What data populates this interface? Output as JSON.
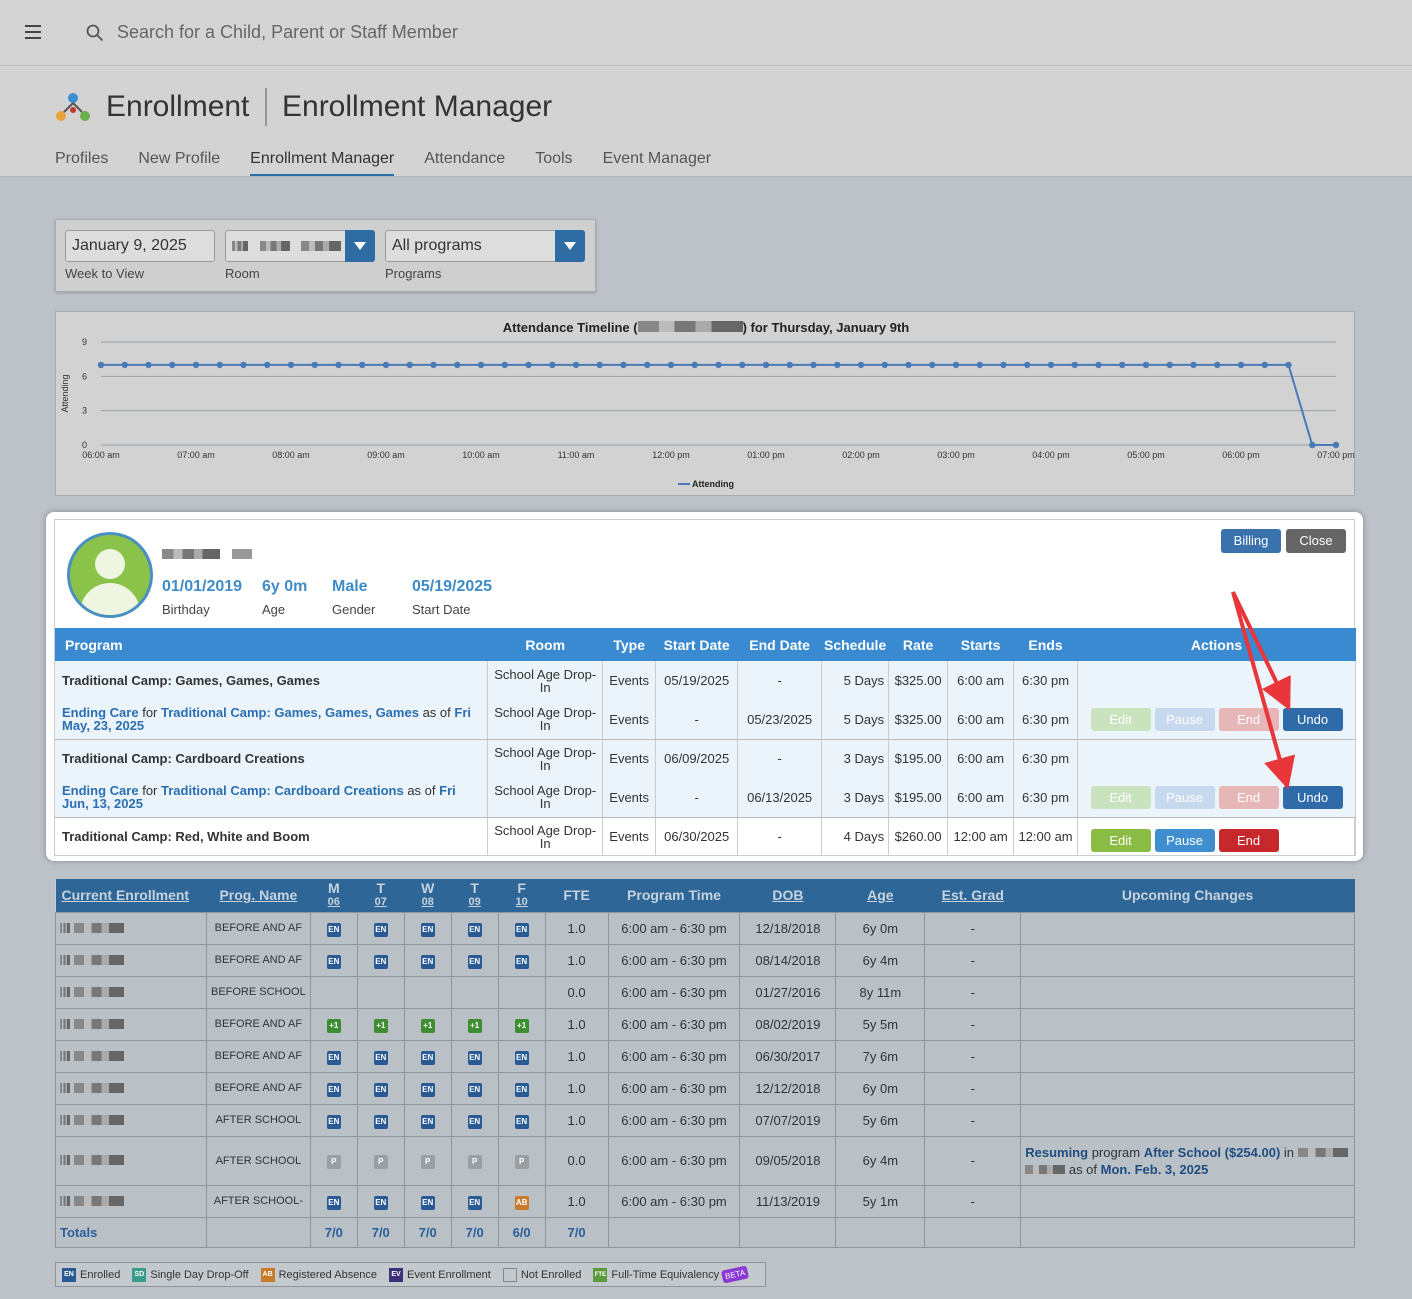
{
  "search": {
    "placeholder": "Search for a Child, Parent or Staff Member"
  },
  "header": {
    "title": "Enrollment",
    "subtitle": "Enrollment Manager"
  },
  "tabs": [
    {
      "label": "Profiles"
    },
    {
      "label": "New Profile"
    },
    {
      "label": "Enrollment Manager",
      "active": true
    },
    {
      "label": "Attendance"
    },
    {
      "label": "Tools"
    },
    {
      "label": "Event Manager"
    }
  ],
  "filters": {
    "week_value": "January 9, 2025",
    "week_label": "Week to View",
    "room_label": "Room",
    "programs_value": "All programs",
    "programs_label": "Programs"
  },
  "chart_data": {
    "type": "line",
    "title_prefix": "Attendance Timeline (",
    "title_suffix": ") for Thursday, January 9th",
    "ylabel": "Attending",
    "ylim": [
      0,
      9
    ],
    "yticks": [
      "0",
      "3",
      "6",
      "9"
    ],
    "xticks": [
      "06:00 am",
      "07:00 am",
      "08:00 am",
      "09:00 am",
      "10:00 am",
      "11:00 am",
      "12:00 pm",
      "01:00 pm",
      "02:00 pm",
      "03:00 pm",
      "04:00 pm",
      "05:00 pm",
      "06:00 pm",
      "07:00 pm"
    ],
    "series": [
      {
        "name": "Attending",
        "color": "#4a7ab5",
        "values": [
          7,
          7,
          7,
          7,
          7,
          7,
          7,
          7,
          7,
          7,
          7,
          7,
          7,
          7,
          7,
          7,
          7,
          7,
          7,
          7,
          7,
          7,
          7,
          7,
          7,
          7,
          7,
          7,
          7,
          7,
          7,
          7,
          7,
          7,
          7,
          7,
          7,
          7,
          7,
          7,
          7,
          7,
          7,
          7,
          7,
          7,
          7,
          7,
          7,
          7,
          7,
          0,
          0
        ]
      }
    ],
    "x_step_minutes": 15,
    "legend": "bottom-center",
    "grid": true
  },
  "profile": {
    "birthday": "01/01/2019",
    "birthday_label": "Birthday",
    "age": "6y 0m",
    "age_label": "Age",
    "gender": "Male",
    "gender_label": "Gender",
    "start_date": "05/19/2025",
    "start_date_label": "Start Date",
    "billing_label": "Billing",
    "close_label": "Close"
  },
  "program_table": {
    "headers": [
      "Program",
      "Room",
      "Type",
      "Start Date",
      "End Date",
      "Schedule",
      "Rate",
      "Starts",
      "Ends",
      "Actions"
    ],
    "action_labels": {
      "edit": "Edit",
      "pause": "Pause",
      "end": "End",
      "undo": "Undo"
    },
    "rows": [
      {
        "program": "Traditional Camp: Games, Games, Games",
        "room": "School Age Drop-In",
        "type": "Events",
        "start": "05/19/2025",
        "end": "-",
        "schedule": "5 Days",
        "rate": "$325.00",
        "starts": "6:00 am",
        "ends": "6:30 pm"
      },
      {
        "ending_prefix": "Ending Care",
        "ending_for": "for",
        "ending_program": "Traditional Camp: Games, Games, Games",
        "ending_asof": "as of",
        "ending_date": "Fri May, 23, 2025",
        "room": "School Age Drop-In",
        "type": "Events",
        "start": "-",
        "end": "05/23/2025",
        "schedule": "5 Days",
        "rate": "$325.00",
        "starts": "6:00 am",
        "ends": "6:30 pm"
      },
      {
        "program": "Traditional Camp: Cardboard Creations",
        "room": "School Age Drop-In",
        "type": "Events",
        "start": "06/09/2025",
        "end": "-",
        "schedule": "3 Days",
        "rate": "$195.00",
        "starts": "6:00 am",
        "ends": "6:30 pm"
      },
      {
        "ending_prefix": "Ending Care",
        "ending_for": "for",
        "ending_program": "Traditional Camp: Cardboard Creations",
        "ending_asof": "as of",
        "ending_date": "Fri Jun, 13, 2025",
        "room": "School Age Drop-In",
        "type": "Events",
        "start": "-",
        "end": "06/13/2025",
        "schedule": "3 Days",
        "rate": "$195.00",
        "starts": "6:00 am",
        "ends": "6:30 pm"
      },
      {
        "program": "Traditional Camp: Red, White and Boom",
        "room": "School Age Drop-In",
        "type": "Events",
        "start": "06/30/2025",
        "end": "-",
        "schedule": "4 Days",
        "rate": "$260.00",
        "starts": "12:00 am",
        "ends": "12:00 am"
      }
    ]
  },
  "enrollment_table": {
    "headers": {
      "current": "Current Enrollment",
      "prog": "Prog. Name",
      "m": "M",
      "m_d": "06",
      "t": "T",
      "t_d": "07",
      "w": "W",
      "w_d": "08",
      "th": "T",
      "th_d": "09",
      "f": "F",
      "f_d": "10",
      "fte": "FTE",
      "time": "Program Time",
      "dob": "DOB",
      "age": "Age",
      "grad": "Est. Grad",
      "changes": "Upcoming Changes"
    },
    "rows": [
      {
        "prog": "BEFORE AND AF",
        "days": [
          "EN",
          "EN",
          "EN",
          "EN",
          "EN"
        ],
        "fte": "1.0",
        "time": "6:00 am - 6:30 pm",
        "dob": "12/18/2018",
        "age": "6y 0m",
        "grad": "-"
      },
      {
        "prog": "BEFORE AND AF",
        "days": [
          "EN",
          "EN",
          "EN",
          "EN",
          "EN"
        ],
        "fte": "1.0",
        "time": "6:00 am - 6:30 pm",
        "dob": "08/14/2018",
        "age": "6y 4m",
        "grad": "-"
      },
      {
        "prog": "BEFORE SCHOOL",
        "days": [
          "",
          "",
          "",
          "",
          ""
        ],
        "fte": "0.0",
        "time": "6:00 am - 6:30 pm",
        "dob": "01/27/2016",
        "age": "8y 11m",
        "grad": "-"
      },
      {
        "prog": "BEFORE AND AF",
        "days": [
          "+1",
          "+1",
          "+1",
          "+1",
          "+1"
        ],
        "fte": "1.0",
        "time": "6:00 am - 6:30 pm",
        "dob": "08/02/2019",
        "age": "5y 5m",
        "grad": "-"
      },
      {
        "prog": "BEFORE AND AF",
        "days": [
          "EN",
          "EN",
          "EN",
          "EN",
          "EN"
        ],
        "fte": "1.0",
        "time": "6:00 am - 6:30 pm",
        "dob": "06/30/2017",
        "age": "7y 6m",
        "grad": "-"
      },
      {
        "prog": "BEFORE AND AF",
        "days": [
          "EN",
          "EN",
          "EN",
          "EN",
          "EN"
        ],
        "fte": "1.0",
        "time": "6:00 am - 6:30 pm",
        "dob": "12/12/2018",
        "age": "6y 0m",
        "grad": "-"
      },
      {
        "prog": "AFTER SCHOOL",
        "days": [
          "EN",
          "EN",
          "EN",
          "EN",
          "EN"
        ],
        "fte": "1.0",
        "time": "6:00 am - 6:30 pm",
        "dob": "07/07/2019",
        "age": "5y 6m",
        "grad": "-"
      },
      {
        "prog": "AFTER SCHOOL",
        "days": [
          "P",
          "P",
          "P",
          "P",
          "P"
        ],
        "fte": "0.0",
        "time": "6:00 am - 6:30 pm",
        "dob": "09/05/2018",
        "age": "6y 4m",
        "grad": "-",
        "change": {
          "a": "Resuming",
          "b": "program",
          "c": "After School ($254.00)",
          "d": "in",
          "e": "as of",
          "f": "Mon. Feb. 3, 2025"
        }
      },
      {
        "prog": "AFTER SCHOOL-",
        "days": [
          "EN",
          "EN",
          "EN",
          "EN",
          "AB"
        ],
        "fte": "1.0",
        "time": "6:00 am - 6:30 pm",
        "dob": "11/13/2019",
        "age": "5y 1m",
        "grad": "-"
      }
    ],
    "totals": {
      "label": "Totals",
      "m": "7/0",
      "t": "7/0",
      "w": "7/0",
      "th": "7/0",
      "f": "6/0",
      "fte": "7/0"
    }
  },
  "legend": {
    "enrolled": "Enrolled",
    "sd": "Single Day Drop-Off",
    "ab": "Registered Absence",
    "ev": "Event Enrollment",
    "ne": "Not Enrolled",
    "fte": "Full-Time Equivalency",
    "beta": "BETA",
    "en_code": "EN",
    "sd_code": "SD",
    "ab_code": "AB",
    "ev_code": "EV",
    "fte_code": "FTE"
  }
}
